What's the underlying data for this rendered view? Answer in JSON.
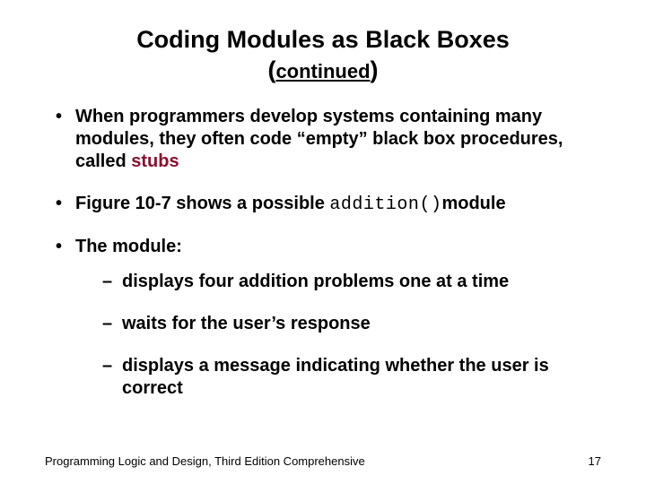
{
  "title_line1": "Coding Modules as Black Boxes",
  "subtitle_open": "(",
  "subtitle_word": "continued",
  "subtitle_close": ")",
  "bullet1_pre": "When programmers develop systems containing many modules, they often code “empty” black box procedures, called ",
  "bullet1_term": "stubs",
  "bullet2_pre": "Figure 10-7 shows a possible ",
  "bullet2_code": "addition()",
  "bullet2_post": "module",
  "bullet3": "The module:",
  "sub1": "displays four addition problems one at a time",
  "sub2": " waits for the user’s response",
  "sub3": "displays a message indicating whether the user is correct",
  "footer_text": "Programming Logic and Design, Third Edition Comprehensive",
  "page_number": "17"
}
